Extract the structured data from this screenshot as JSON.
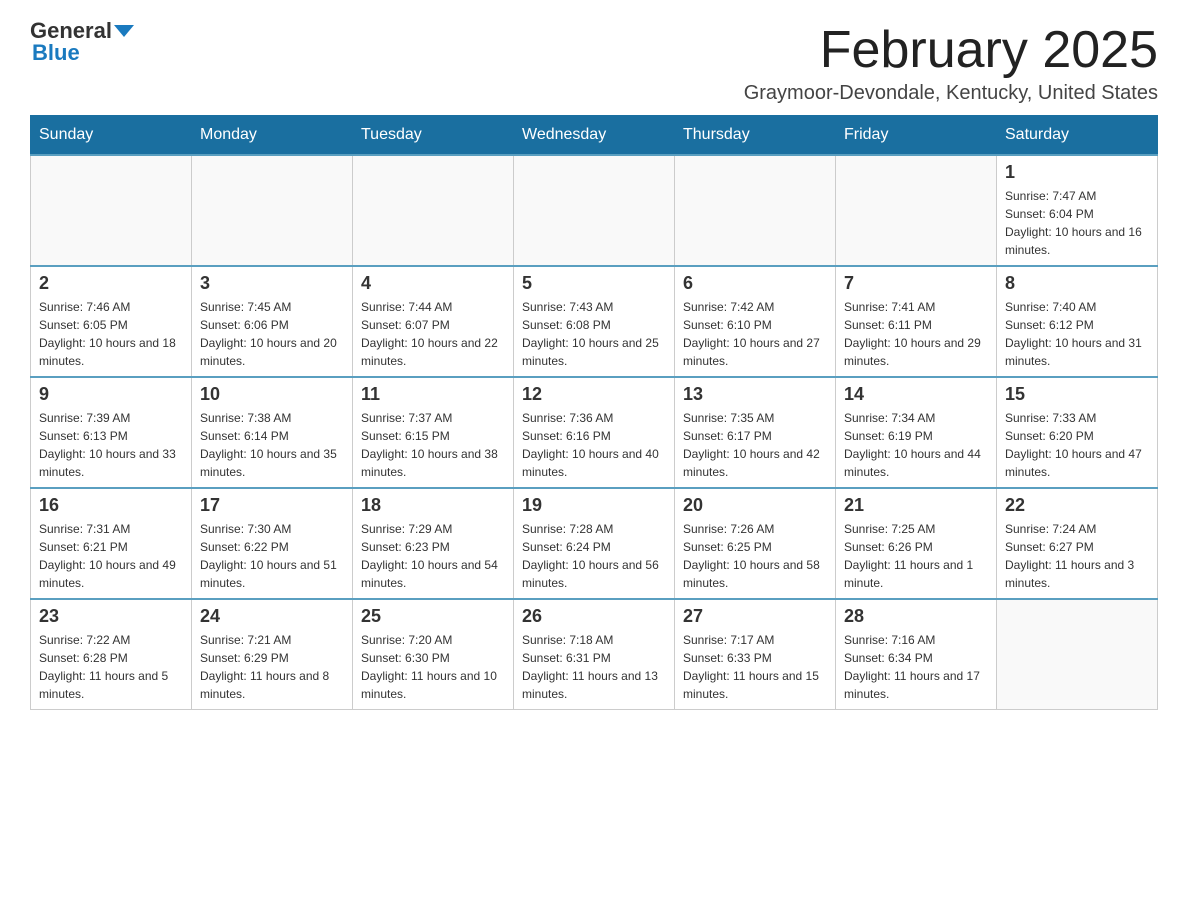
{
  "header": {
    "logo_line1": "General",
    "logo_line2": "Blue",
    "month_title": "February 2025",
    "location": "Graymoor-Devondale, Kentucky, United States"
  },
  "weekdays": [
    "Sunday",
    "Monday",
    "Tuesday",
    "Wednesday",
    "Thursday",
    "Friday",
    "Saturday"
  ],
  "weeks": [
    [
      {
        "day": "",
        "info": ""
      },
      {
        "day": "",
        "info": ""
      },
      {
        "day": "",
        "info": ""
      },
      {
        "day": "",
        "info": ""
      },
      {
        "day": "",
        "info": ""
      },
      {
        "day": "",
        "info": ""
      },
      {
        "day": "1",
        "info": "Sunrise: 7:47 AM\nSunset: 6:04 PM\nDaylight: 10 hours and 16 minutes."
      }
    ],
    [
      {
        "day": "2",
        "info": "Sunrise: 7:46 AM\nSunset: 6:05 PM\nDaylight: 10 hours and 18 minutes."
      },
      {
        "day": "3",
        "info": "Sunrise: 7:45 AM\nSunset: 6:06 PM\nDaylight: 10 hours and 20 minutes."
      },
      {
        "day": "4",
        "info": "Sunrise: 7:44 AM\nSunset: 6:07 PM\nDaylight: 10 hours and 22 minutes."
      },
      {
        "day": "5",
        "info": "Sunrise: 7:43 AM\nSunset: 6:08 PM\nDaylight: 10 hours and 25 minutes."
      },
      {
        "day": "6",
        "info": "Sunrise: 7:42 AM\nSunset: 6:10 PM\nDaylight: 10 hours and 27 minutes."
      },
      {
        "day": "7",
        "info": "Sunrise: 7:41 AM\nSunset: 6:11 PM\nDaylight: 10 hours and 29 minutes."
      },
      {
        "day": "8",
        "info": "Sunrise: 7:40 AM\nSunset: 6:12 PM\nDaylight: 10 hours and 31 minutes."
      }
    ],
    [
      {
        "day": "9",
        "info": "Sunrise: 7:39 AM\nSunset: 6:13 PM\nDaylight: 10 hours and 33 minutes."
      },
      {
        "day": "10",
        "info": "Sunrise: 7:38 AM\nSunset: 6:14 PM\nDaylight: 10 hours and 35 minutes."
      },
      {
        "day": "11",
        "info": "Sunrise: 7:37 AM\nSunset: 6:15 PM\nDaylight: 10 hours and 38 minutes."
      },
      {
        "day": "12",
        "info": "Sunrise: 7:36 AM\nSunset: 6:16 PM\nDaylight: 10 hours and 40 minutes."
      },
      {
        "day": "13",
        "info": "Sunrise: 7:35 AM\nSunset: 6:17 PM\nDaylight: 10 hours and 42 minutes."
      },
      {
        "day": "14",
        "info": "Sunrise: 7:34 AM\nSunset: 6:19 PM\nDaylight: 10 hours and 44 minutes."
      },
      {
        "day": "15",
        "info": "Sunrise: 7:33 AM\nSunset: 6:20 PM\nDaylight: 10 hours and 47 minutes."
      }
    ],
    [
      {
        "day": "16",
        "info": "Sunrise: 7:31 AM\nSunset: 6:21 PM\nDaylight: 10 hours and 49 minutes."
      },
      {
        "day": "17",
        "info": "Sunrise: 7:30 AM\nSunset: 6:22 PM\nDaylight: 10 hours and 51 minutes."
      },
      {
        "day": "18",
        "info": "Sunrise: 7:29 AM\nSunset: 6:23 PM\nDaylight: 10 hours and 54 minutes."
      },
      {
        "day": "19",
        "info": "Sunrise: 7:28 AM\nSunset: 6:24 PM\nDaylight: 10 hours and 56 minutes."
      },
      {
        "day": "20",
        "info": "Sunrise: 7:26 AM\nSunset: 6:25 PM\nDaylight: 10 hours and 58 minutes."
      },
      {
        "day": "21",
        "info": "Sunrise: 7:25 AM\nSunset: 6:26 PM\nDaylight: 11 hours and 1 minute."
      },
      {
        "day": "22",
        "info": "Sunrise: 7:24 AM\nSunset: 6:27 PM\nDaylight: 11 hours and 3 minutes."
      }
    ],
    [
      {
        "day": "23",
        "info": "Sunrise: 7:22 AM\nSunset: 6:28 PM\nDaylight: 11 hours and 5 minutes."
      },
      {
        "day": "24",
        "info": "Sunrise: 7:21 AM\nSunset: 6:29 PM\nDaylight: 11 hours and 8 minutes."
      },
      {
        "day": "25",
        "info": "Sunrise: 7:20 AM\nSunset: 6:30 PM\nDaylight: 11 hours and 10 minutes."
      },
      {
        "day": "26",
        "info": "Sunrise: 7:18 AM\nSunset: 6:31 PM\nDaylight: 11 hours and 13 minutes."
      },
      {
        "day": "27",
        "info": "Sunrise: 7:17 AM\nSunset: 6:33 PM\nDaylight: 11 hours and 15 minutes."
      },
      {
        "day": "28",
        "info": "Sunrise: 7:16 AM\nSunset: 6:34 PM\nDaylight: 11 hours and 17 minutes."
      },
      {
        "day": "",
        "info": ""
      }
    ]
  ]
}
